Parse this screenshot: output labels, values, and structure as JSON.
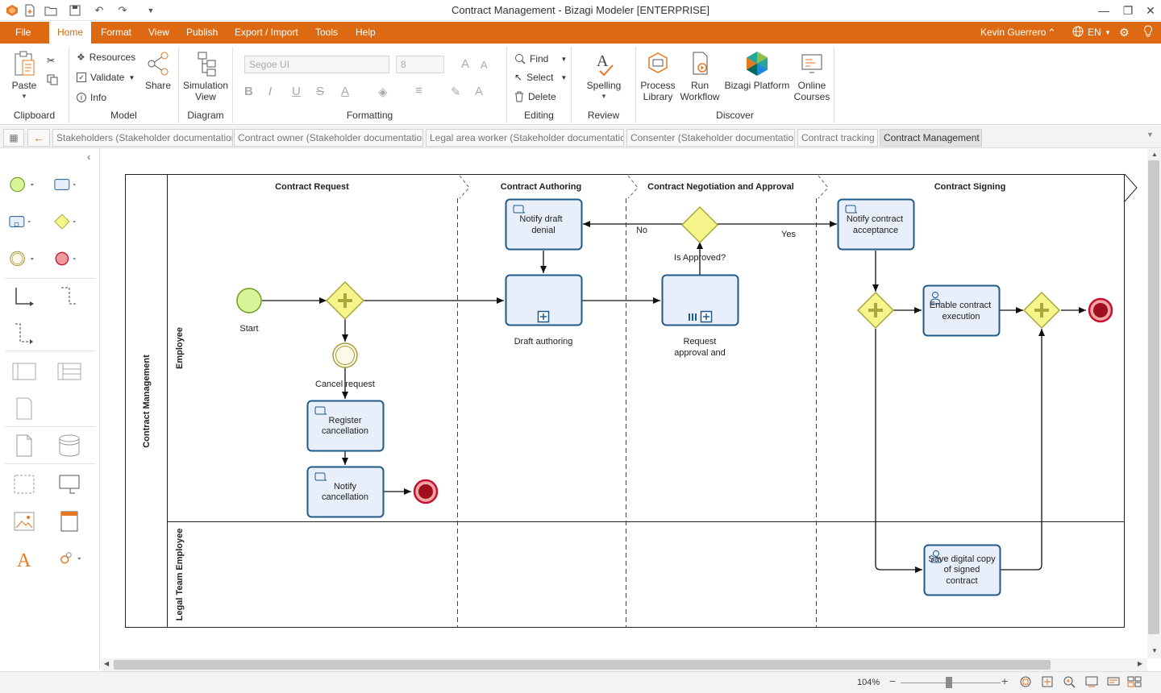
{
  "app": {
    "title": "Contract Management - Bizagi Modeler [ENTERPRISE]"
  },
  "menu": {
    "file": "File",
    "tabs": [
      "Home",
      "Format",
      "View",
      "Publish",
      "Export / Import",
      "Tools",
      "Help"
    ],
    "active_tab": "Home",
    "user": "Kevin Guerrero",
    "language": "EN"
  },
  "ribbon": {
    "clipboard": {
      "paste": "Paste",
      "label": "Clipboard"
    },
    "model": {
      "resources": "Resources",
      "validate": "Validate",
      "info": "Info",
      "share": "Share",
      "label": "Model"
    },
    "diagram": {
      "simulation_line1": "Simulation",
      "simulation_line2": "View",
      "label": "Diagram"
    },
    "formatting": {
      "font": "Segoe UI",
      "size": "8",
      "label": "Formatting"
    },
    "editing": {
      "find": "Find",
      "select": "Select",
      "delete": "Delete",
      "label": "Editing"
    },
    "review": {
      "spelling": "Spelling",
      "label": "Review"
    },
    "discover": {
      "process_line1": "Process",
      "process_line2": "Library",
      "run_line1": "Run",
      "run_line2": "Workflow",
      "platform": "Bizagi Platform",
      "courses_line1": "Online",
      "courses_line2": "Courses",
      "label": "Discover"
    }
  },
  "doc_tabs": [
    "Stakeholders (Stakeholder documentation)",
    "Contract owner (Stakeholder documentation)",
    "Legal area worker (Stakeholder documentation)",
    "Consenter (Stakeholder documentation)",
    "Contract tracking",
    "Contract Management"
  ],
  "diagram": {
    "pool": "Contract Management",
    "lanes": [
      "Employee",
      "Legal Team Employee"
    ],
    "phases": [
      "Contract Request",
      "Contract Authoring",
      "Contract Negotiation and Approval",
      "Contract Signing"
    ],
    "events": {
      "start": "Start",
      "cancel": "Cancel request"
    },
    "tasks": {
      "register_l1": "Register",
      "register_l2": "cancellation",
      "notify_cancel_l1": "Notify",
      "notify_cancel_l2": "cancellation",
      "notify_denial_l1": "Notify draft",
      "notify_denial_l2": "denial",
      "draft": "Draft authoring",
      "request_l1": "Request",
      "request_l2": "approval and",
      "notify_accept_l1": "Notify contract",
      "notify_accept_l2": "acceptance",
      "enable_l1": "Enable contract",
      "enable_l2": "execution",
      "save_l1": "Save digital copy",
      "save_l2": "of signed",
      "save_l3": "contract"
    },
    "gateway_approved": "Is Approved?",
    "flow_no": "No",
    "flow_yes": "Yes"
  },
  "status": {
    "zoom": "104%"
  },
  "colors": {
    "accent": "#dd6a12",
    "task_fill": "#e8eefa",
    "task_stroke": "#1f5a8a",
    "start_fill": "#d9f59a",
    "start_stroke": "#6e9c1a",
    "gateway_fill": "#f5f58c",
    "gateway_stroke": "#a8a83c",
    "end_fill": "#c8102e"
  }
}
